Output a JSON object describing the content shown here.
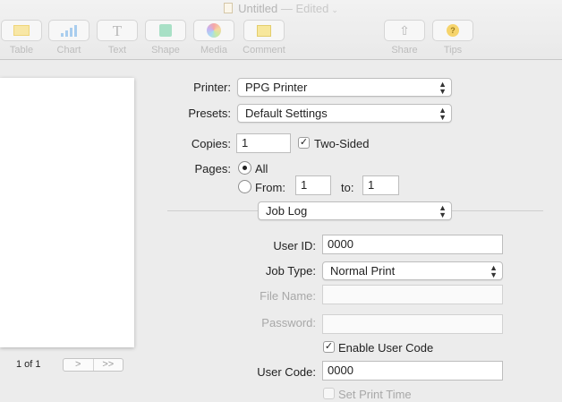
{
  "window": {
    "title": "Untitled",
    "status": "— Edited"
  },
  "toolbar": {
    "items": [
      {
        "label": "Table"
      },
      {
        "label": "Chart"
      },
      {
        "label": "Text"
      },
      {
        "label": "Shape"
      },
      {
        "label": "Media"
      },
      {
        "label": "Comment"
      },
      {
        "label": "Share"
      },
      {
        "label": "Tips"
      }
    ]
  },
  "preview": {
    "page_count": "1 of 1",
    "next": ">",
    "last": ">>"
  },
  "print": {
    "printer_label": "Printer:",
    "printer_value": "PPG Printer",
    "presets_label": "Presets:",
    "presets_value": "Default Settings",
    "copies_label": "Copies:",
    "copies_value": "1",
    "two_sided_label": "Two-Sided",
    "two_sided_checked": true,
    "pages_label": "Pages:",
    "pages_all_label": "All",
    "pages_from_label": "From:",
    "pages_from_value": "1",
    "pages_to_label": "to:",
    "pages_to_value": "1",
    "section_value": "Job Log",
    "user_id_label": "User ID:",
    "user_id_value": "0000",
    "job_type_label": "Job Type:",
    "job_type_value": "Normal Print",
    "file_name_label": "File Name:",
    "password_label": "Password:",
    "enable_user_code_label": "Enable User Code",
    "enable_user_code_checked": true,
    "user_code_label": "User Code:",
    "user_code_value": "0000",
    "set_print_time_label": "Set Print Time",
    "check_mark": "✓",
    "popup_arrows_up": "▲",
    "popup_arrows_down": "▼"
  }
}
